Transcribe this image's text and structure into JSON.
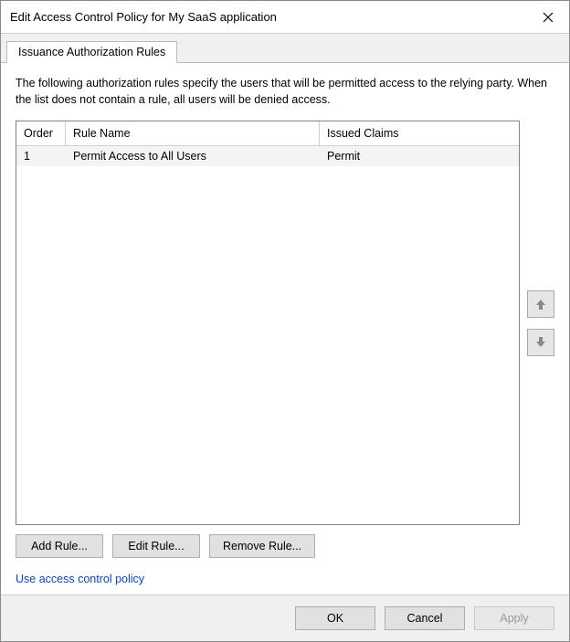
{
  "window": {
    "title": "Edit Access Control Policy for My SaaS application"
  },
  "tabs": [
    {
      "label": "Issuance Authorization Rules"
    }
  ],
  "description": "The following authorization rules specify the users that will be permitted access to the relying party. When the list does not contain a rule, all users will be denied access.",
  "table": {
    "headers": {
      "order": "Order",
      "rule_name": "Rule Name",
      "issued_claims": "Issued Claims"
    },
    "rows": [
      {
        "order": "1",
        "rule_name": "Permit Access to All Users",
        "issued_claims": "Permit"
      }
    ]
  },
  "buttons": {
    "add_rule": "Add Rule...",
    "edit_rule": "Edit Rule...",
    "remove_rule": "Remove Rule...",
    "ok": "OK",
    "cancel": "Cancel",
    "apply": "Apply"
  },
  "link": {
    "use_policy": "Use access control policy"
  }
}
